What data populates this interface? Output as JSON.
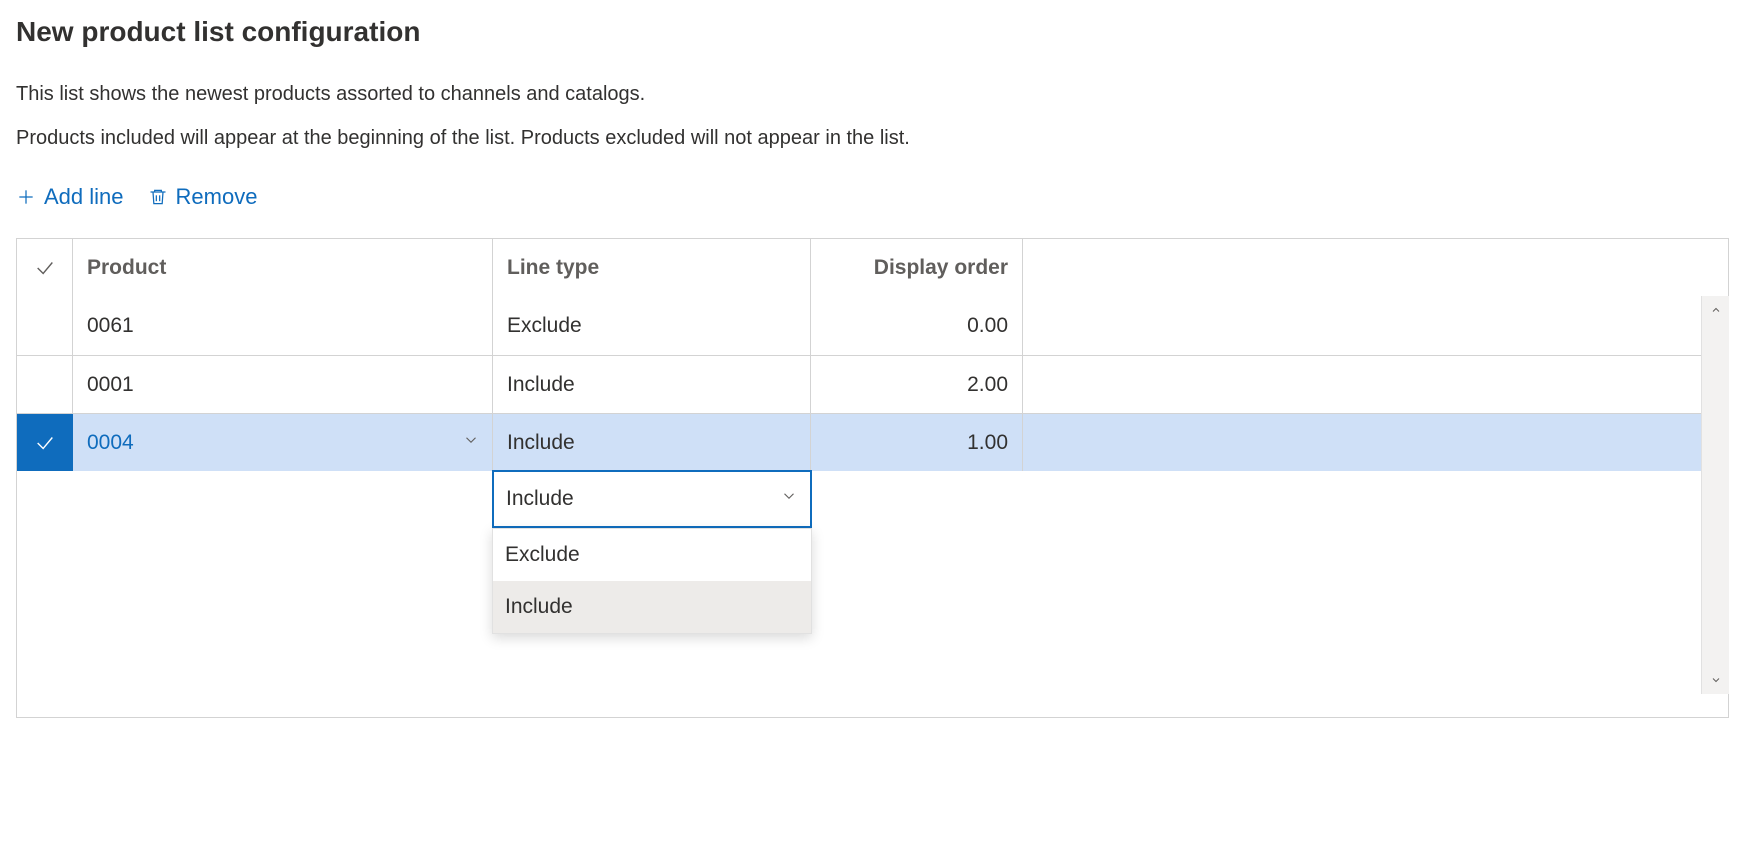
{
  "page": {
    "title": "New product list configuration",
    "description1": "This list shows the newest products assorted to channels and catalogs.",
    "description2": "Products included will appear at the beginning of the list. Products excluded will not appear in the list."
  },
  "toolbar": {
    "add_line": "Add line",
    "remove": "Remove"
  },
  "grid": {
    "headers": {
      "product": "Product",
      "line_type": "Line type",
      "display_order": "Display order"
    },
    "rows": [
      {
        "product": "0061",
        "line_type": "Exclude",
        "display_order": "0.00",
        "selected": false
      },
      {
        "product": "0001",
        "line_type": "Include",
        "display_order": "2.00",
        "selected": false
      },
      {
        "product": "0004",
        "line_type": "Include",
        "display_order": "1.00",
        "selected": true
      }
    ]
  },
  "dropdown": {
    "current": "Include",
    "options": [
      {
        "label": "Exclude",
        "highlighted": false
      },
      {
        "label": "Include",
        "highlighted": true
      }
    ]
  }
}
